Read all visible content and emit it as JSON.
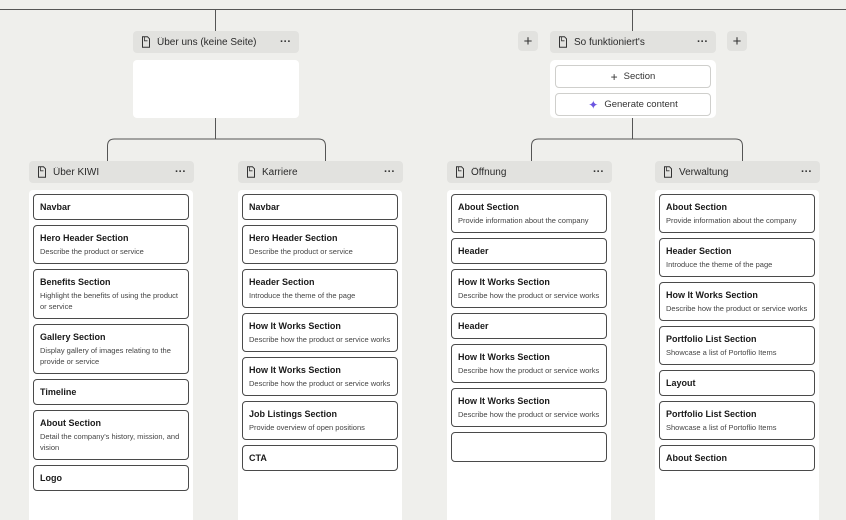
{
  "top_nodes": [
    {
      "title": "Über uns (keine Seite)",
      "menu": "···"
    },
    {
      "title": "So funktioniert's",
      "menu": "···"
    }
  ],
  "add_label": "+",
  "add_section": {
    "icon": "+",
    "label": "Section"
  },
  "generate": {
    "icon": "✦",
    "label": "Generate content"
  },
  "columns": [
    {
      "title": "Über KIWI",
      "menu": "···",
      "cards": [
        {
          "title": "Navbar",
          "desc": ""
        },
        {
          "title": "Hero Header Section",
          "desc": "Describe the product or service"
        },
        {
          "title": "Benefits Section",
          "desc": "Highlight the benefits of using the product or service"
        },
        {
          "title": "Gallery Section",
          "desc": "Display gallery of images relating to the provide or service"
        },
        {
          "title": "Timeline",
          "desc": ""
        },
        {
          "title": "About Section",
          "desc": "Detail the company's history, mission, and vision"
        },
        {
          "title": "Logo",
          "desc": ""
        }
      ]
    },
    {
      "title": "Karriere",
      "menu": "···",
      "cards": [
        {
          "title": "Navbar",
          "desc": ""
        },
        {
          "title": "Hero Header Section",
          "desc": "Describe the product or service"
        },
        {
          "title": "Header Section",
          "desc": "Introduce the theme of the page"
        },
        {
          "title": "How It Works Section",
          "desc": "Describe how the product or service works"
        },
        {
          "title": "How It Works Section",
          "desc": "Describe how the product or service works"
        },
        {
          "title": "Job Listings Section",
          "desc": "Provide overview of open positions"
        },
        {
          "title": "CTA",
          "desc": ""
        }
      ]
    },
    {
      "title": "Öffnung",
      "menu": "···",
      "cards": [
        {
          "title": "About Section",
          "desc": "Provide information about the company"
        },
        {
          "title": "Header",
          "desc": ""
        },
        {
          "title": "How It Works Section",
          "desc": "Describe how the product or service works"
        },
        {
          "title": "Header",
          "desc": ""
        },
        {
          "title": "How It Works Section",
          "desc": "Describe how the product or service works"
        },
        {
          "title": "How It Works Section",
          "desc": "Describe how the product or service works"
        },
        {
          "title": "",
          "desc": ""
        }
      ]
    },
    {
      "title": "Verwaltung",
      "menu": "···",
      "cards": [
        {
          "title": "About Section",
          "desc": "Provide information about the company"
        },
        {
          "title": "Header Section",
          "desc": "Introduce the theme of the page"
        },
        {
          "title": "How It Works Section",
          "desc": "Describe how the product or service works"
        },
        {
          "title": "Portfolio List Section",
          "desc": "Showcase a list of Portoflio Items"
        },
        {
          "title": "Layout",
          "desc": ""
        },
        {
          "title": "Portfolio List Section",
          "desc": "Showcase a list of Portoflio Items"
        },
        {
          "title": "About Section",
          "desc": ""
        }
      ]
    }
  ]
}
